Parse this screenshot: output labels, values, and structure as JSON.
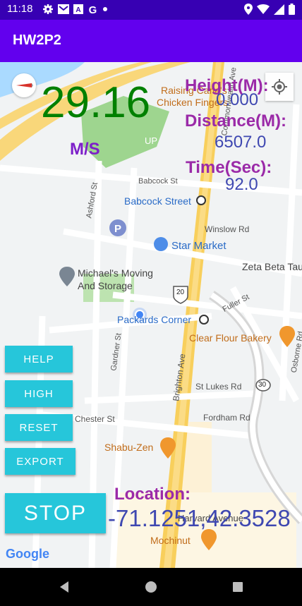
{
  "status_bar": {
    "time": "11:18",
    "icons_left": [
      "gear-icon",
      "mail-icon",
      "text-icon",
      "google-icon",
      "dot-icon"
    ],
    "icons_right": [
      "location-icon",
      "wifi-icon",
      "signal-icon",
      "battery-icon"
    ]
  },
  "app": {
    "title": "HW2P2"
  },
  "readouts": {
    "speed": "29.16",
    "speed_unit": "M/S",
    "height_label": "Height(M):",
    "height_value": "0.000",
    "distance_label": "Distance(M):",
    "distance_value": "6507.0",
    "time_label": "Time(Sec):",
    "time_value": "92.0",
    "location_label": "Location:",
    "location_value": "-71.1251,42.3528"
  },
  "buttons": {
    "help": "HELP",
    "high": "HIGH",
    "reset": "RESET",
    "export": "EXPORT",
    "stop": "STOP"
  },
  "map": {
    "places": {
      "babcock_street": "Babcock Street",
      "winslow_rd": "Winslow Rd",
      "star_market": "Star Market",
      "zeta_beta_tau": "Zeta Beta Tau",
      "michaels_moving_1": "Michael's Moving",
      "michaels_moving_2": "And Storage",
      "packards_corner": "Packards Corner",
      "fuller_st": "Fuller St",
      "clear_flour": "Clear Flour Bakery",
      "st_lukes": "St Lukes Rd",
      "fordham": "Fordham Rd",
      "chester": "Chester St",
      "shabu_zen": "Shabu-Zen",
      "harvard_ave": "Harvard Avenue",
      "mochinut": "Mochinut",
      "raising_canes_1": "Raising Cane's",
      "raising_canes_2": "Chicken Fingers",
      "babcock_st_side": "Babcock St",
      "ashford_st": "Ashford St",
      "gardner_st": "Gardner St",
      "brighton_ave": "Brighton Ave",
      "commonwealth": "Commonwealth Ave",
      "osborne": "Osborne Rd",
      "route_20": "20",
      "route_30": "30",
      "google": "Google",
      "up": "UP"
    }
  },
  "colors": {
    "status_bar": "#3700b3",
    "app_bar": "#6200ee",
    "speed": "#008000",
    "label": "#9b2aa8",
    "value": "#3f48b1",
    "button": "#26c6da"
  }
}
